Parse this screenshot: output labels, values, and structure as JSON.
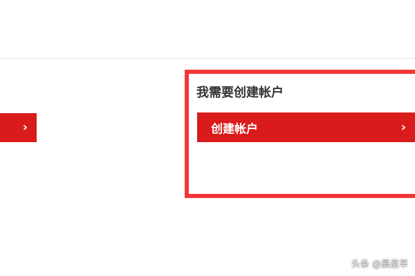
{
  "colors": {
    "accent": "#d91b1b",
    "highlight_border": "#f23636",
    "heading_text": "#333333",
    "divider": "#e3e3e3"
  },
  "left_panel": {
    "button_icon": "chevron-right-icon",
    "button_icon_glyph": "›"
  },
  "create_account_panel": {
    "heading": "我需要创建帐户",
    "button_label": "创建帐户",
    "button_icon": "chevron-right-icon",
    "button_icon_glyph": "›"
  },
  "watermark": {
    "text": "头条 @晨星早"
  }
}
